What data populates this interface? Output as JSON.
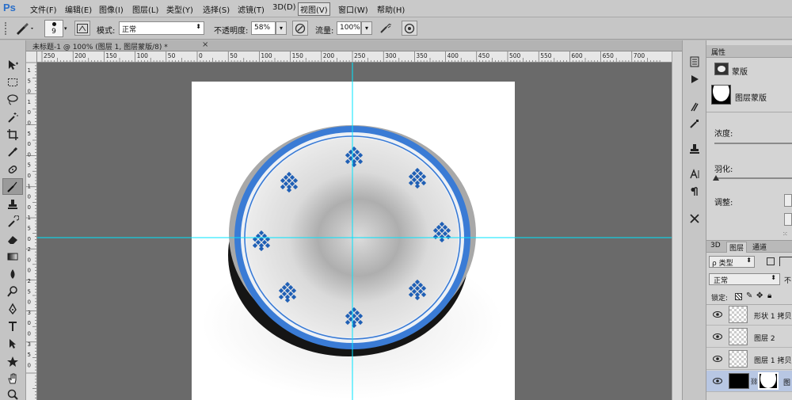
{
  "app": {
    "logo": "Ps"
  },
  "menu": [
    {
      "label": "文件(F)"
    },
    {
      "label": "编辑(E)"
    },
    {
      "label": "图像(I)"
    },
    {
      "label": "图层(L)"
    },
    {
      "label": "类型(Y)"
    },
    {
      "label": "选择(S)"
    },
    {
      "label": "滤镜(T)"
    },
    {
      "label": "3D(D)"
    },
    {
      "label": "视图(V)",
      "active": true
    },
    {
      "label": "窗口(W)"
    },
    {
      "label": "帮助(H)"
    }
  ],
  "options": {
    "brush_size": "9",
    "mode_label": "模式:",
    "mode_value": "正常",
    "opacity_label": "不透明度:",
    "opacity_value": "58%",
    "flow_label": "流量:",
    "flow_value": "100%"
  },
  "document": {
    "tab_title": "未标题-1 @ 100% (图层 1, 图层蒙版/8) *",
    "close_glyph": "×"
  },
  "ruler": {
    "h_ticks": [
      "250",
      "200",
      "150",
      "100",
      "50",
      "0",
      "50",
      "100",
      "150",
      "200",
      "250",
      "300",
      "350",
      "400",
      "450",
      "500",
      "550",
      "600",
      "650",
      "700"
    ],
    "v_ticks": [
      "1",
      "5",
      "0",
      "1",
      "0",
      "0",
      "5",
      "0",
      "0",
      "5",
      "0",
      "1",
      "0",
      "0",
      "1",
      "5",
      "0",
      "2",
      "0",
      "0",
      "2",
      "5",
      "0",
      "3",
      "0",
      "0",
      "3",
      "5",
      "0"
    ]
  },
  "properties": {
    "tab": "属性",
    "mask_title": "蒙版",
    "layer_mask_label": "图层蒙版",
    "density_label": "浓度:",
    "feather_label": "羽化:",
    "adjust_label": "调整:"
  },
  "layers": {
    "tabs": [
      "3D",
      "图层",
      "通道"
    ],
    "active_tab": "图层",
    "filter_kind": "ρ 类型",
    "blend_mode": "正常",
    "opacity_short": "不",
    "lock_label": "锁定:",
    "items": [
      {
        "name": "形状 1 拷贝"
      },
      {
        "name": "图层 2"
      },
      {
        "name": "图层 1 拷贝"
      },
      {
        "name": "图"
      }
    ]
  },
  "colors": {
    "accent_blue": "#3a7bd5",
    "guide_cyan": "#00e5ff",
    "canvas_bg": "#6a6a6a",
    "motif_blue": "#1f5fb5"
  }
}
